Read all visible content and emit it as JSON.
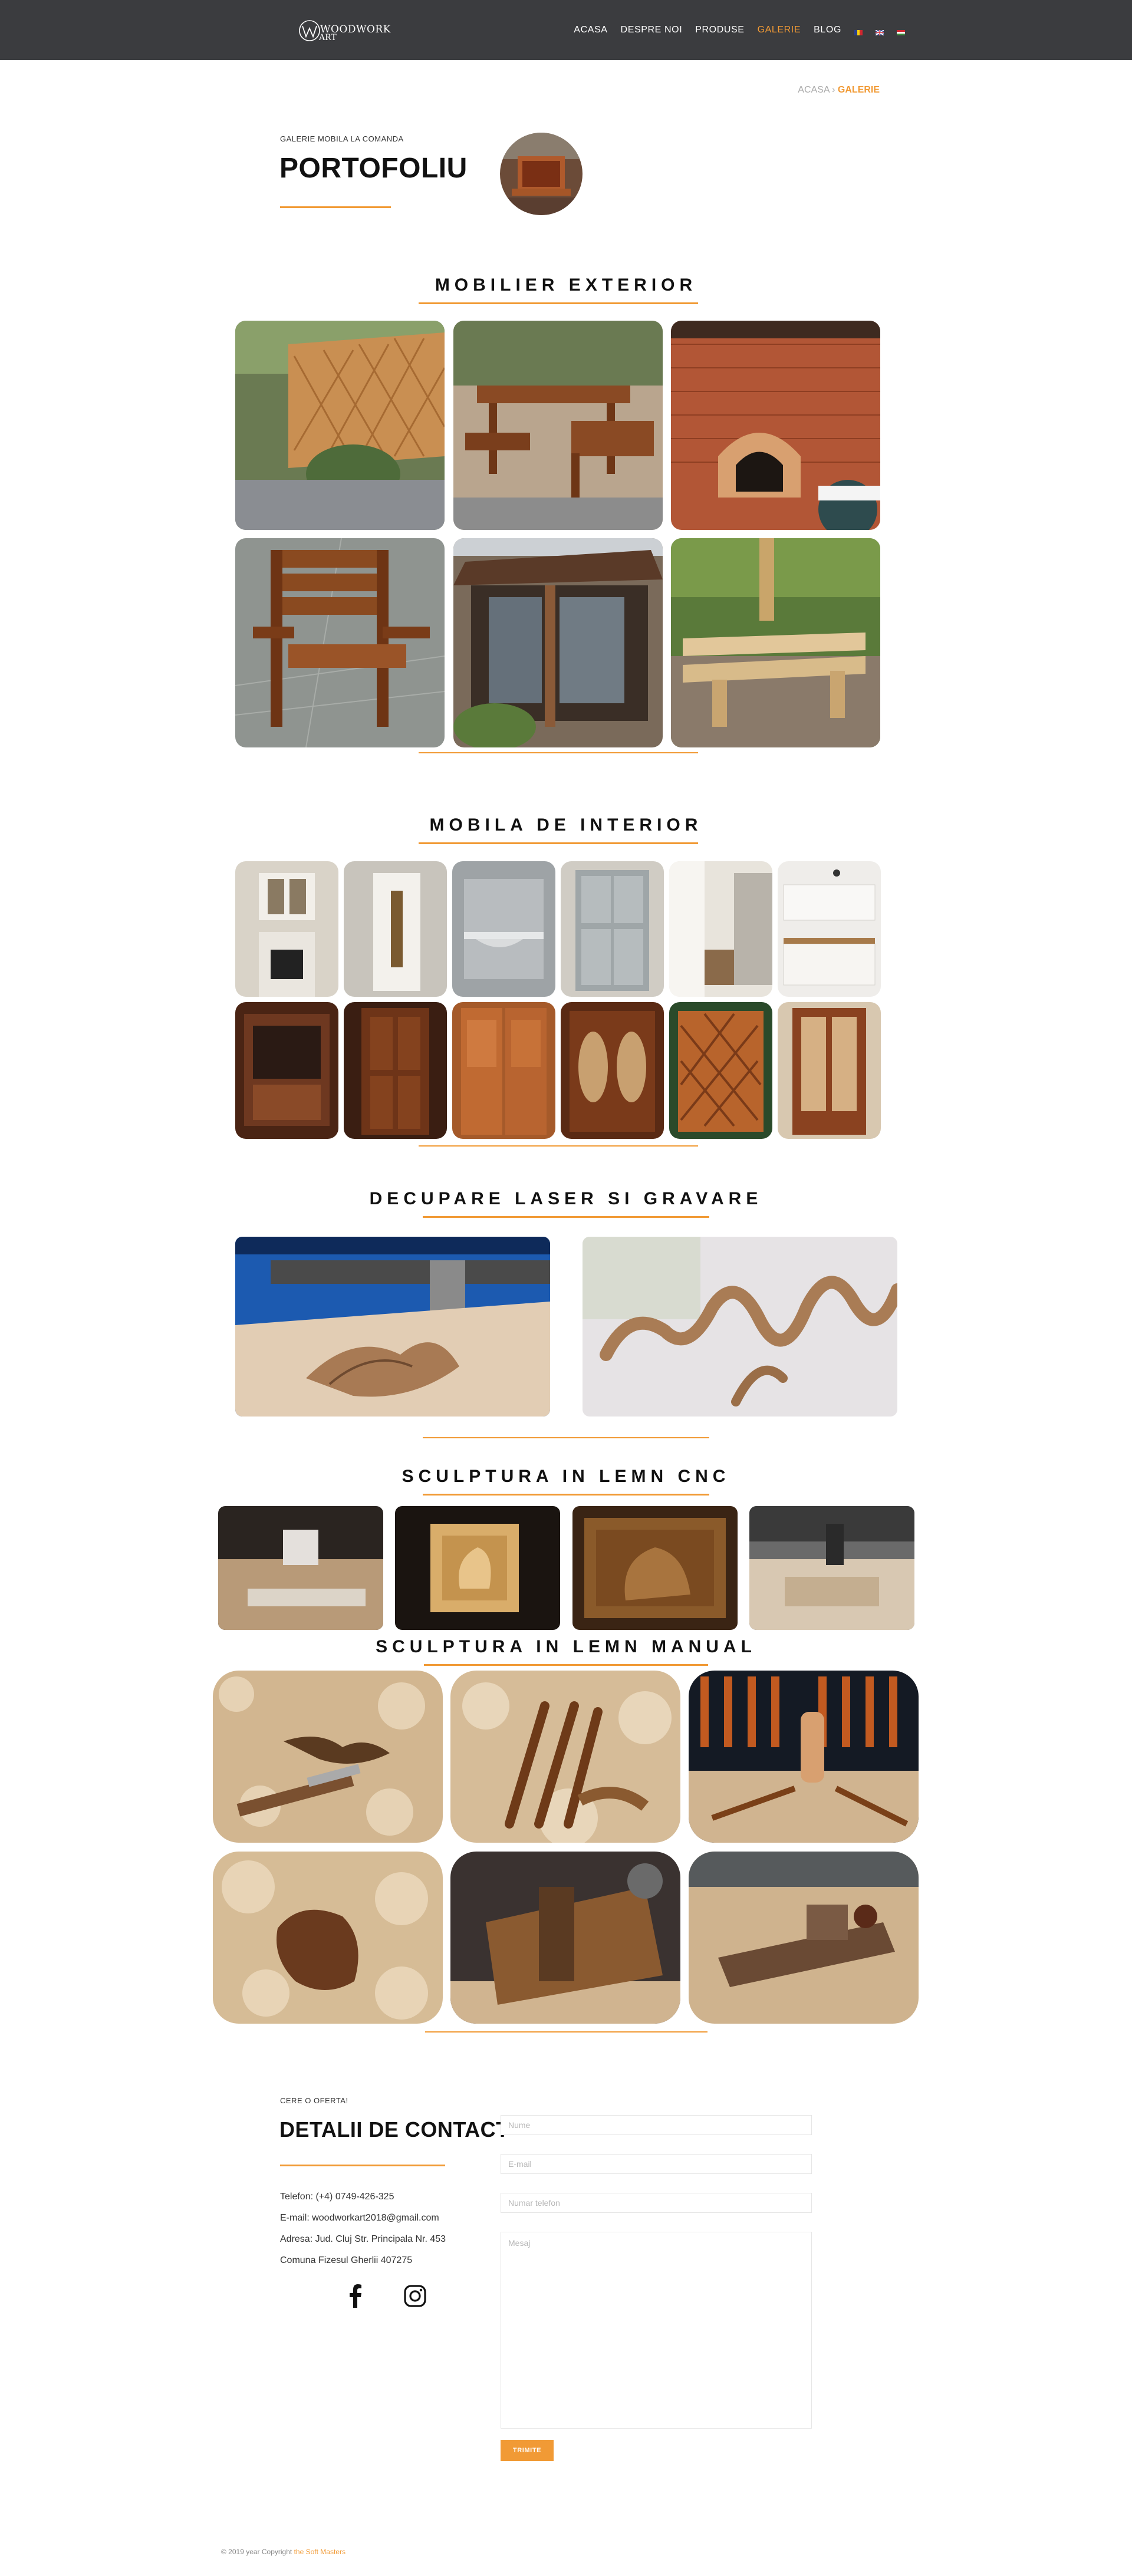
{
  "nav": {
    "logo_text_top": "WOODWORK",
    "logo_text_bottom": "ART",
    "items": [
      {
        "label": "ACASA"
      },
      {
        "label": "DESPRE NOI"
      },
      {
        "label": "PRODUSE"
      },
      {
        "label": "GALERIE"
      },
      {
        "label": "BLOG"
      }
    ],
    "active_item": "GALERIE",
    "flags": [
      "romania-flag-icon",
      "uk-flag-icon",
      "hungary-flag-icon"
    ]
  },
  "breadcrumb": {
    "home": "ACASA",
    "separator": "›",
    "current": "GALERIE"
  },
  "header": {
    "eyebrow": "GALERIE MOBILA LA COMANDA",
    "title": "PORTOFOLIU"
  },
  "sections": {
    "exterior": {
      "title": "MOBILIER EXTERIOR"
    },
    "interior": {
      "title": "MOBILA DE INTERIOR"
    },
    "laser": {
      "title": "DECUPARE LASER SI GRAVARE"
    },
    "cnc": {
      "title": "SCULPTURA IN LEMN CNC"
    },
    "manual": {
      "title": "SCULPTURA IN LEMN MANUAL"
    }
  },
  "contact": {
    "eyebrow": "CERE O OFERTA!",
    "title": "DETALII DE CONTACT",
    "phone": "Telefon: (+4) 0749-426-325",
    "email": "E-mail: woodworkart2018@gmail.com",
    "address": "Adresa: Jud. Cluj Str. Principala Nr. 453",
    "address2": "Comuna Fizesul Gherlii 407275",
    "form": {
      "name_placeholder": "Nume",
      "email_placeholder": "E-mail",
      "phone_placeholder": "Numar telefon",
      "message_placeholder": "Mesaj",
      "submit_label": "TRIMITE"
    }
  },
  "footer": {
    "text": "© 2019 year Copyright",
    "brand": "the Soft Masters"
  },
  "colors": {
    "accent": "#f19a35",
    "nav_bg": "#3b3c3f"
  }
}
